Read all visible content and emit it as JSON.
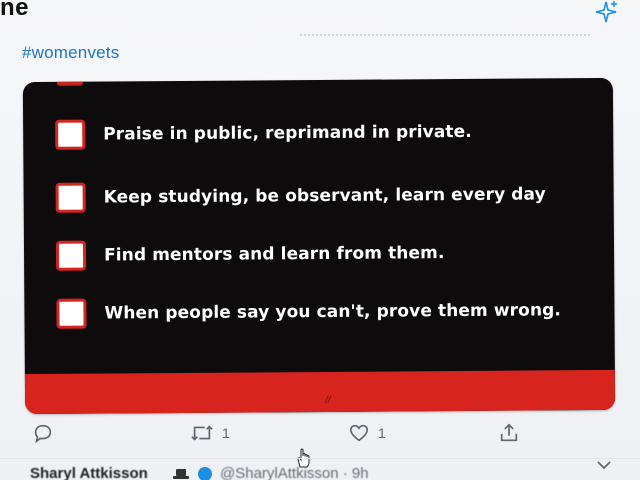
{
  "header": {
    "title_fragment": "ne",
    "sparkle_icon": "sparkle-icon"
  },
  "tweet": {
    "hashtag": "#womenvets",
    "image": {
      "items": [
        "Praise in public, reprimand in private.",
        "Keep studying, be observant, learn every day",
        "Find mentors and learn from them.",
        "When people say you can't, prove them wrong."
      ],
      "band_mark": "//",
      "colors": {
        "card_background": "#0d0b0b",
        "checkbox_border": "#d4261f",
        "band": "#d8241e"
      }
    },
    "actions": {
      "reply_icon": "reply-icon",
      "retweet_icon": "retweet-icon",
      "retweet_count": "1",
      "like_icon": "heart-icon",
      "like_count": "1",
      "share_icon": "share-icon"
    }
  },
  "next_tweet": {
    "author": "Sharyl Attkisson",
    "handle": "@SharylAttkisson · 9h"
  },
  "colors": {
    "link": "#1d74c4",
    "icon_gray": "#5b6670"
  }
}
